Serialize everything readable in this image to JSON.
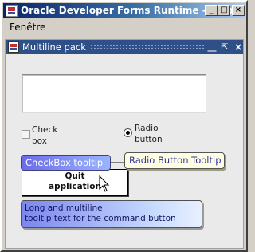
{
  "window": {
    "title": "Oracle Developer Forms Runtime - Web",
    "controls": {
      "minimize": "_",
      "maximize": "□",
      "close": "×"
    }
  },
  "menubar": {
    "items": [
      "Fenêtre"
    ]
  },
  "inner_window": {
    "title": "Multiline pack",
    "controls": {
      "minimize": "⎽",
      "maximize": "⇱",
      "close": "×"
    }
  },
  "form": {
    "textarea_value": "",
    "checkbox": {
      "label": "Check\nbox",
      "checked": false
    },
    "radio": {
      "label": "Radio\nbutton",
      "selected": true
    },
    "quit_button": {
      "label": "Quit\napplication"
    }
  },
  "tooltips": {
    "checkbox": "CheckBox tooltip",
    "radio": "Radio Button Tooltip",
    "quit": "Long and multiline\ntooltip text for the command button"
  },
  "colors": {
    "title_bar_start": "#0a246a",
    "title_bar_end": "#a6caf0",
    "inner_title": "#2f4f88",
    "tooltip_checkbox": "#6b6be8",
    "tooltip_radio_bg": "#ffffe4",
    "tooltip_quit": "#7a86ee"
  },
  "icons": {
    "app": "oracle-forms-icon",
    "inner": "oracle-forms-icon",
    "cursor": "arrow-pointer-icon"
  }
}
